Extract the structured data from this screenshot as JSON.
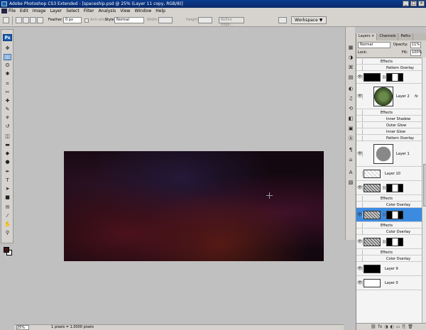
{
  "app": {
    "title": "Adobe Photoshop CS3 Extended - [spaceship.psd @ 25% (Layer 11 copy, RGB/8)]",
    "window_buttons": [
      "_",
      "□",
      "×"
    ]
  },
  "menu": [
    "File",
    "Edit",
    "Image",
    "Layer",
    "Select",
    "Filter",
    "Analysis",
    "View",
    "Window",
    "Help"
  ],
  "options": {
    "feather_label": "Feather:",
    "feather_value": "0 px",
    "antialias_label": "Anti-alias",
    "style_label": "Style:",
    "style_value": "Normal",
    "width_label": "Width:",
    "height_label": "Height:",
    "refine_edge": "Refine Edge...",
    "workspace": "Workspace ▼"
  },
  "tools": {
    "logo": "Ps",
    "icons": [
      "move-icon",
      "marquee-icon",
      "lasso-icon",
      "magic-wand-icon",
      "crop-icon",
      "slice-icon",
      "healing-icon",
      "brush-icon",
      "clone-stamp-icon",
      "history-brush-icon",
      "eraser-icon",
      "gradient-icon",
      "blur-icon",
      "dodge-icon",
      "pen-icon",
      "type-icon",
      "path-select-icon",
      "shape-icon",
      "notes-icon",
      "eyedropper-icon",
      "hand-icon",
      "zoom-icon"
    ],
    "glyphs": [
      "✥",
      "⬚",
      "ʘ",
      "✱",
      "⌗",
      "✂",
      "✚",
      "✎",
      "⚘",
      "↺",
      "◫",
      "▬",
      "◆",
      "●",
      "✒",
      "T",
      "➤",
      "■",
      "✉",
      "⁄",
      "✋",
      "⚲"
    ],
    "fg_color": "#3b1a14",
    "bg_color": "#ffffff"
  },
  "status": {
    "zoom": "25%",
    "doc_info": "1 pixels = 1.0000 pixels"
  },
  "dock": {
    "glyphs": [
      "▦",
      "◑",
      "⌘",
      "▤",
      "◐",
      "♫",
      "⟲",
      "◧",
      "▣",
      "Ⓐ",
      "¶",
      "⌂",
      "A",
      "▧"
    ]
  },
  "layers_panel": {
    "tabs": [
      "Layers ×",
      "Channels",
      "Paths"
    ],
    "blend_mode": "Normal",
    "opacity_label": "Opacity:",
    "opacity_value": "11%",
    "lock_label": "Lock:",
    "fill_label": "Fill:",
    "fill_value": "100%",
    "rows": [
      {
        "kind": "effects",
        "label": "Effects"
      },
      {
        "kind": "effect",
        "label": "Pattern Overlay"
      },
      {
        "kind": "layer-mask",
        "name": ""
      },
      {
        "kind": "layer",
        "name": "Layer 2",
        "fx": "fx"
      },
      {
        "kind": "effects",
        "label": "Effects"
      },
      {
        "kind": "effect",
        "label": "Inner Shadow"
      },
      {
        "kind": "effect",
        "label": "Outer Glow"
      },
      {
        "kind": "effect",
        "label": "Inner Glow"
      },
      {
        "kind": "effect",
        "label": "Pattern Overlay"
      },
      {
        "kind": "layer",
        "name": "Layer 1"
      },
      {
        "kind": "layer",
        "name": "Layer 10"
      },
      {
        "kind": "layer",
        "name": ""
      },
      {
        "kind": "effects",
        "label": "Effects"
      },
      {
        "kind": "effect",
        "label": "Color Overlay"
      },
      {
        "kind": "layer",
        "name": ""
      },
      {
        "kind": "effects",
        "label": "Effects"
      },
      {
        "kind": "effect",
        "label": "Color Overlay"
      },
      {
        "kind": "layer",
        "name": ""
      },
      {
        "kind": "effects",
        "label": "Effects"
      },
      {
        "kind": "effect",
        "label": "Color Overlay"
      },
      {
        "kind": "layer",
        "name": "Layer 9"
      },
      {
        "kind": "layer",
        "name": "Layer 0"
      }
    ],
    "bottom_glyphs": [
      "⛓",
      "fx",
      "◑",
      "◐",
      "▭",
      "⎘",
      "🗑"
    ]
  }
}
